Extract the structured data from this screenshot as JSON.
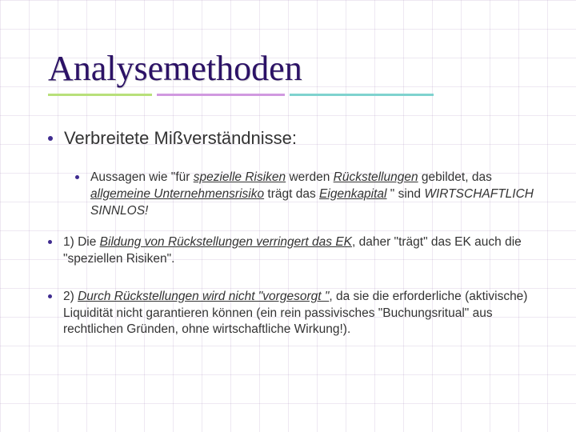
{
  "title": "Analysemethoden",
  "heading": "Verbreitete Mißverständnisse:",
  "sub": {
    "t1": "Aussagen wie \"für ",
    "t2": "spezielle Risiken",
    "t3": " werden ",
    "t4": "Rückstellungen",
    "t5": " gebildet, das ",
    "t6": "allgemeine Unternehmensrisiko",
    "t7": " trägt das ",
    "t8": "Eigenkapital",
    "t9": " \" sind ",
    "t10": "WIRTSCHAFTLICH SINNLOS!"
  },
  "p1": {
    "t1": "1) Die ",
    "t2": "Bildung von Rückstellungen verringert das EK",
    "t3": ", daher \"trägt\" das EK auch die \"speziellen Risiken\"."
  },
  "p2": {
    "t1": "2) ",
    "t2": "Durch Rückstellungen wird nicht  \"vorgesorgt \"",
    "t3": ", da sie die erforderliche (aktivische) Liquidität nicht garantieren können (ein rein passivisches \"Buchungsritual\" aus rechtlichen Gründen, ohne wirtschaftliche Wirkung!)."
  }
}
